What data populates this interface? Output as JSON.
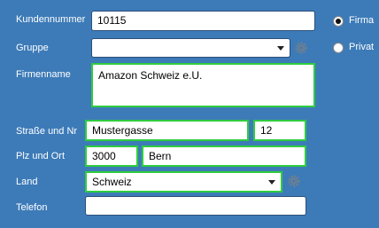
{
  "form": {
    "kundennummer": {
      "label": "Kundennummer",
      "value": "10115"
    },
    "gruppe": {
      "label": "Gruppe",
      "value": ""
    },
    "firmenname": {
      "label": "Firmenname",
      "value": "Amazon Schweiz e.U."
    },
    "strasse": {
      "label": "Straße und Nr",
      "street_value": "Mustergasse",
      "number_value": "12"
    },
    "plz_ort": {
      "label": "Plz und Ort",
      "plz_value": "3000",
      "ort_value": "Bern"
    },
    "land": {
      "label": "Land",
      "value": "Schweiz"
    },
    "telefon": {
      "label": "Telefon",
      "value": ""
    }
  },
  "customer_type": {
    "options": [
      {
        "label": "Firma",
        "selected": true
      },
      {
        "label": "Privat",
        "selected": false
      }
    ]
  },
  "colors": {
    "background": "#3d7bb8",
    "highlight_border": "#2ecc40",
    "gear": "#6f7f8f"
  },
  "icons": {
    "gruppe_settings": "gear-icon",
    "land_settings": "gear-icon",
    "dropdown": "chevron-down-icon"
  }
}
